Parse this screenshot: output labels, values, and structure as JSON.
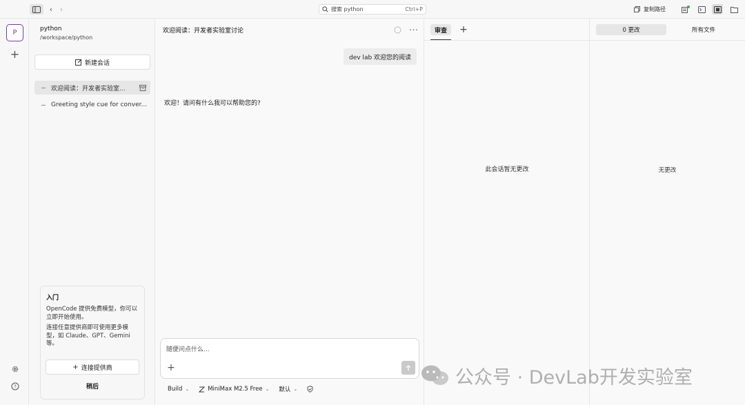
{
  "topbar": {
    "search_placeholder": "搜索 python",
    "search_shortcut": "Ctrl+P",
    "copy_path_label": "复制路径"
  },
  "rail": {
    "avatar_letter": "P"
  },
  "sidebar": {
    "project_name": "python",
    "project_path": "/workspace/python",
    "new_chat_label": "新建会话",
    "conversations": [
      {
        "label": "欢迎阅读：开发者实验室..."
      },
      {
        "label": "Greeting style cue for conver..."
      }
    ],
    "getting_started": {
      "title": "入门",
      "text1": "OpenCode 提供免费模型，你可以立即开始使用。",
      "text2": "连接任意提供商即可使用更多模型，如 Claude、GPT、Gemini 等。",
      "connect_label": "连接提供商",
      "later_label": "稍后"
    }
  },
  "chat": {
    "title": "欢迎阅读：开发者实验室讨论",
    "user_message": "dev lab 欢迎您的阅读",
    "assistant_message": "欢迎！请问有什么我可以帮助您的?",
    "composer_placeholder": "随便问点什么...",
    "toolbar": {
      "agent": "Build",
      "model": "MiniMax M2.5 Free",
      "variant": "默认"
    }
  },
  "review": {
    "tab_label": "审查",
    "empty_text": "此会话暂无更改"
  },
  "files": {
    "changes_tab": "0 更改",
    "all_files_tab": "所有文件",
    "empty_text": "无更改"
  },
  "watermark": {
    "text": "公众号 · DevLab开发实验室"
  }
}
